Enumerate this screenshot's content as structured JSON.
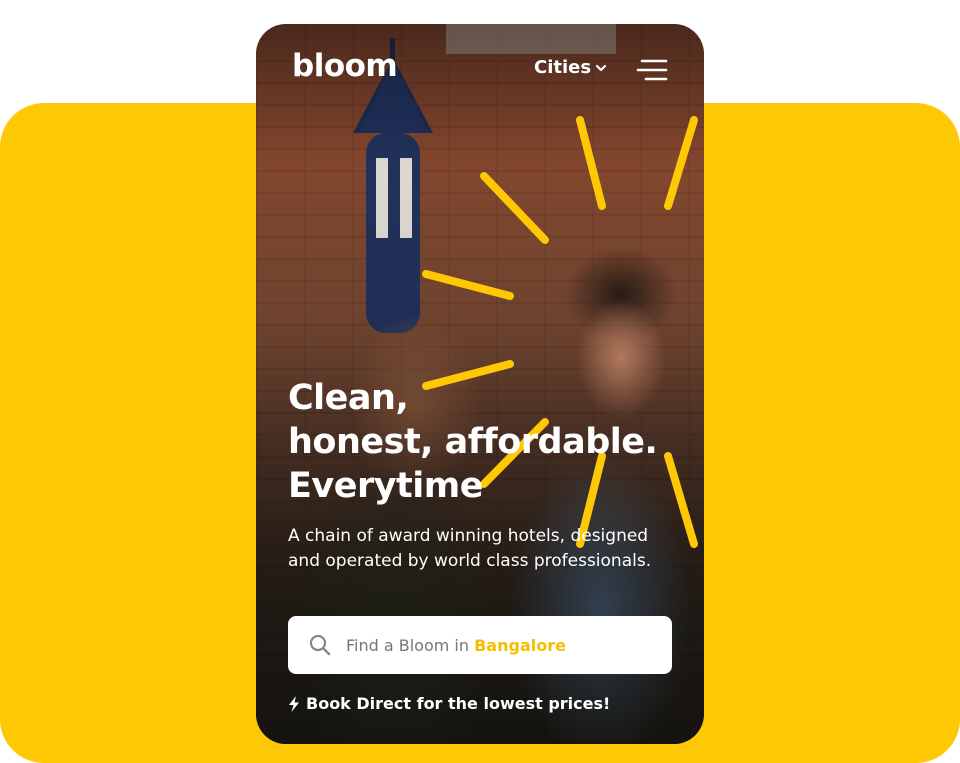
{
  "brand": {
    "logo_text": "bloom"
  },
  "nav": {
    "cities_label": "Cities"
  },
  "hero": {
    "headline_lines": [
      "Clean,",
      "honest, affordable.",
      "Everytime"
    ],
    "subtext": "A chain of award winning hotels, designed and operated by world class professionals."
  },
  "search": {
    "prefix": "Find a Bloom in",
    "city": "Bangalore"
  },
  "promo": {
    "text": "Book Direct for the lowest prices!"
  },
  "colors": {
    "accent": "#FFC804",
    "text_on_photo": "#FFFFFF"
  },
  "icons": [
    "chevron-down-icon",
    "hamburger-menu-icon",
    "search-icon",
    "lightning-bolt-icon"
  ]
}
